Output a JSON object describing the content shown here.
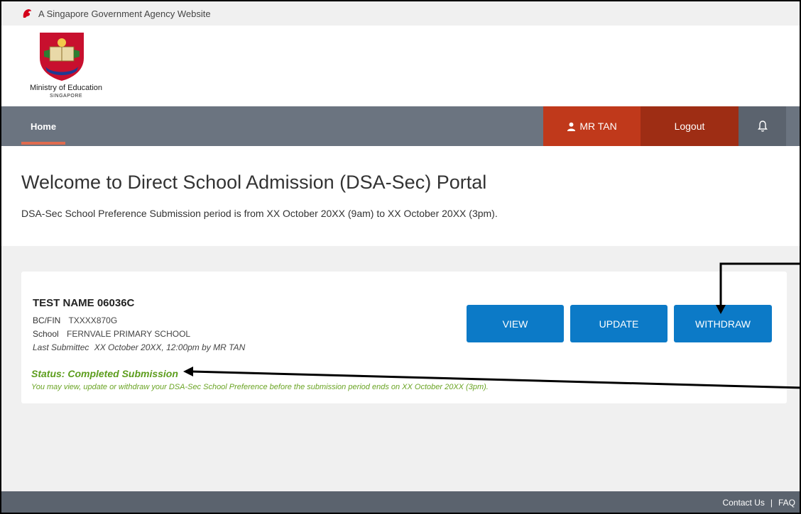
{
  "gov_bar": {
    "text": "A Singapore Government Agency Website"
  },
  "header": {
    "org_name": "Ministry of Education",
    "org_sub": "SINGAPORE"
  },
  "nav": {
    "home": "Home",
    "user": "MR TAN",
    "logout": "Logout"
  },
  "welcome": {
    "title": "Welcome to Direct School Admission (DSA-Sec) Portal",
    "subtitle": "DSA-Sec School Preference Submission period is from XX October 20XX (9am) to XX October 20XX (3pm)."
  },
  "card": {
    "student_name": "TEST NAME 06036C",
    "bcfin_label": "BC/FIN",
    "bcfin_value": "TXXXX870G",
    "school_label": "School",
    "school_value": "FERNVALE PRIMARY SCHOOL",
    "submitted_label": "Last Submittec",
    "submitted_value": "XX October 20XX, 12:00pm by MR TAN",
    "buttons": {
      "view": "VIEW",
      "update": "UPDATE",
      "withdraw": "WITHDRAW"
    },
    "status_title": "Status: Completed Submission",
    "status_desc": "You may view, update or withdraw your DSA-Sec School Preference before the submission period ends on XX October 20XX (3pm)."
  },
  "footer": {
    "contact": "Contact Us",
    "sep": "|",
    "faq": "FAQ"
  },
  "colors": {
    "nav_bg": "#6b7480",
    "user_bg": "#c0391b",
    "logout_bg": "#9e2d14",
    "button_blue": "#0c7ac7",
    "status_green": "#5c9d1c",
    "footer_bg": "#5b636e"
  },
  "icons": {
    "gov": "lion-head-icon",
    "user": "user-icon",
    "bell": "bell-icon",
    "crest": "moe-crest-icon"
  }
}
